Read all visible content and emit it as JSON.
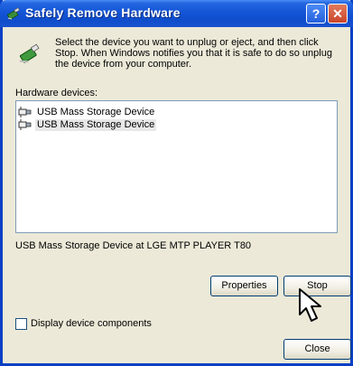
{
  "window": {
    "title": "Safely Remove Hardware",
    "help_button": "?",
    "close_button": "✕"
  },
  "instructions": "Select the device you want to unplug or eject, and then click Stop. When Windows notifies you that it is safe to do so unplug the device from your computer.",
  "hardware_label": "Hardware devices:",
  "devices": [
    {
      "label": "USB Mass Storage Device",
      "selected": false
    },
    {
      "label": "USB Mass Storage Device",
      "selected": true
    }
  ],
  "status_text": "USB Mass Storage Device at LGE MTP PLAYER T80",
  "buttons": {
    "properties": "Properties",
    "stop": "Stop",
    "close": "Close"
  },
  "checkbox": {
    "label": "Display device components",
    "checked": false
  },
  "colors": {
    "titlebar": "#1455d6",
    "dialog_bg": "#ece9d8",
    "selection": "#e8e8e8"
  }
}
